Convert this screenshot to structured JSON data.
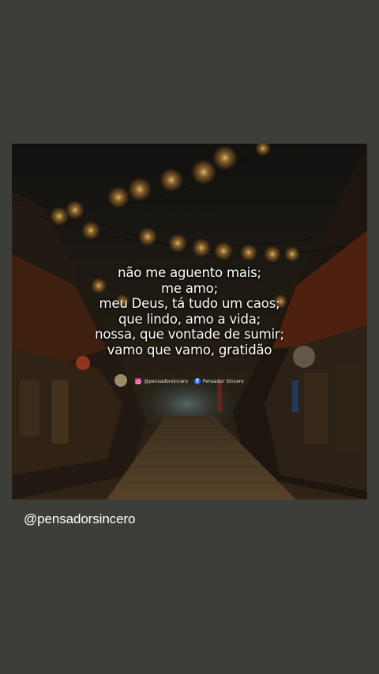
{
  "post": {
    "quote_lines": [
      "não me aguento mais;",
      "me amo;",
      "meu Deus, tá tudo um caos;",
      "que lindo, amo a vida;",
      "nossa, que vontade de sumir;",
      "vamo que vamo, gratidão"
    ],
    "credits": {
      "instagram": "@pensadorsincero",
      "facebook": "Pensador Sincero"
    }
  },
  "caption": {
    "handle": "@pensadorsincero"
  },
  "colors": {
    "background": "#3d3e39",
    "text": "#ffffff",
    "light_bulb": "#ffd27a"
  }
}
